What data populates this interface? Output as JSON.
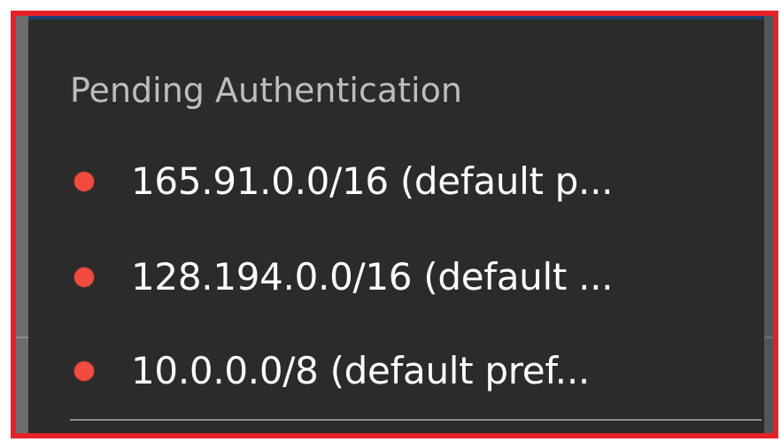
{
  "menu": {
    "header": "Pending Authentication",
    "items": [
      {
        "label": "165.91.0.0/16 (default p...",
        "status_icon": "red-status-dot-icon"
      },
      {
        "label": "128.194.0.0/16 (default ...",
        "status_icon": "red-status-dot-icon"
      },
      {
        "label": "10.0.0.0/8 (default pref...",
        "status_icon": "red-status-dot-icon"
      }
    ]
  },
  "colors": {
    "selection_outline": "#e3212b",
    "menu_background": "#2b2b2b",
    "header_text": "#bdbdbd",
    "item_text": "#ffffff",
    "status_dot": "#f24b3f",
    "divider": "#8d8d8d",
    "top_accent": "#1f3f73"
  }
}
